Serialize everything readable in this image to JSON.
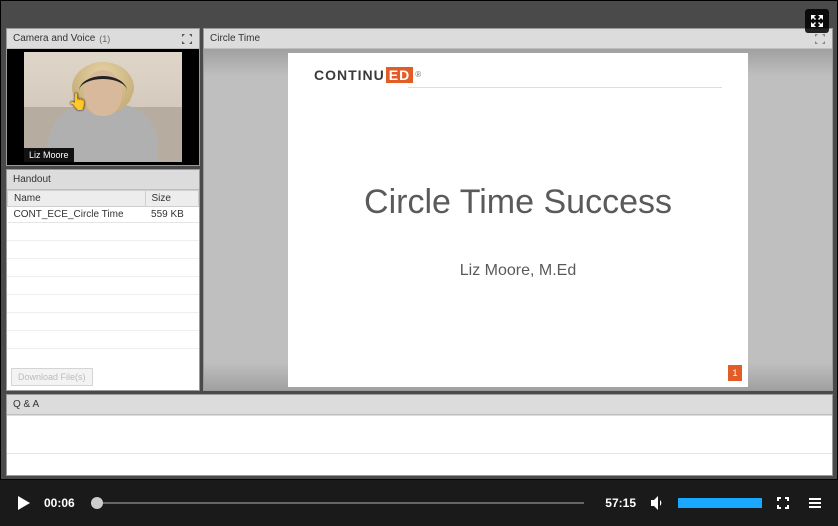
{
  "camera": {
    "title": "Camera and Voice",
    "count": "(1)",
    "presenter_name": "Liz Moore"
  },
  "handout": {
    "title": "Handout",
    "columns": {
      "name": "Name",
      "size": "Size"
    },
    "rows": [
      {
        "name": "CONT_ECE_Circle Time",
        "size": "559 KB"
      }
    ],
    "download_label": "Download File(s)"
  },
  "slide": {
    "panel_title": "Circle Time",
    "brand_left": "CONTINU",
    "brand_box": "ED",
    "title": "Circle Time Success",
    "subtitle": "Liz Moore, M.Ed",
    "page_number": "1"
  },
  "qa": {
    "title": "Q & A"
  },
  "player": {
    "current_time": "00:06",
    "total_time": "57:15",
    "progress_pct": 0.17,
    "volume_pct": 100
  }
}
